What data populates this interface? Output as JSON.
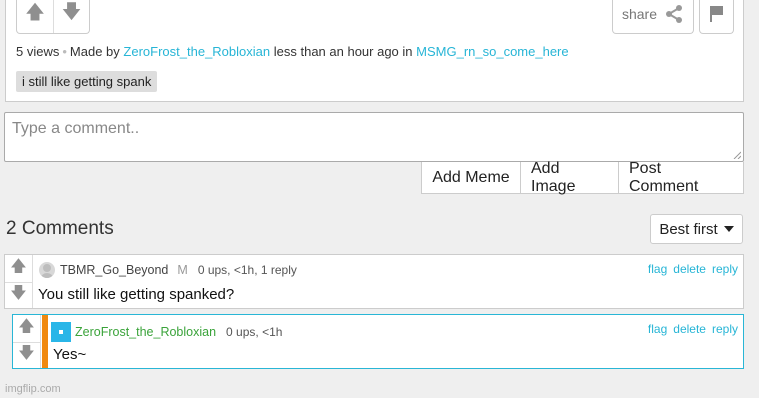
{
  "post": {
    "views": "5 views",
    "made_by": "Made by",
    "author": "ZeroFrost_the_Robloxian",
    "time": "less than an hour ago in",
    "stream": "MSMG_rn_so_come_here",
    "tag": "i still like getting spank",
    "share_label": "share"
  },
  "comment_form": {
    "placeholder": "Type a comment..",
    "add_meme": "Add Meme",
    "add_image": "Add Image",
    "post_comment": "Post Comment"
  },
  "comments_section": {
    "heading": "2 Comments",
    "sort_label": "Best first"
  },
  "comments": [
    {
      "username": "TBMR_Go_Beyond",
      "badge": "M",
      "meta": "0 ups, <1h, 1 reply",
      "text": "You still like getting spanked?",
      "links": [
        "flag",
        "delete",
        "reply"
      ]
    },
    {
      "username": "ZeroFrost_the_Robloxian",
      "meta": "0 ups, <1h",
      "text": "Yes~",
      "links": [
        "flag",
        "delete",
        "reply"
      ]
    }
  ],
  "watermark": "imgflip.com",
  "colors": {
    "link": "#27b5d6",
    "reply_stripe": "#f0890f",
    "reply_border": "#29b6d6",
    "op_name": "#3aa33a"
  }
}
